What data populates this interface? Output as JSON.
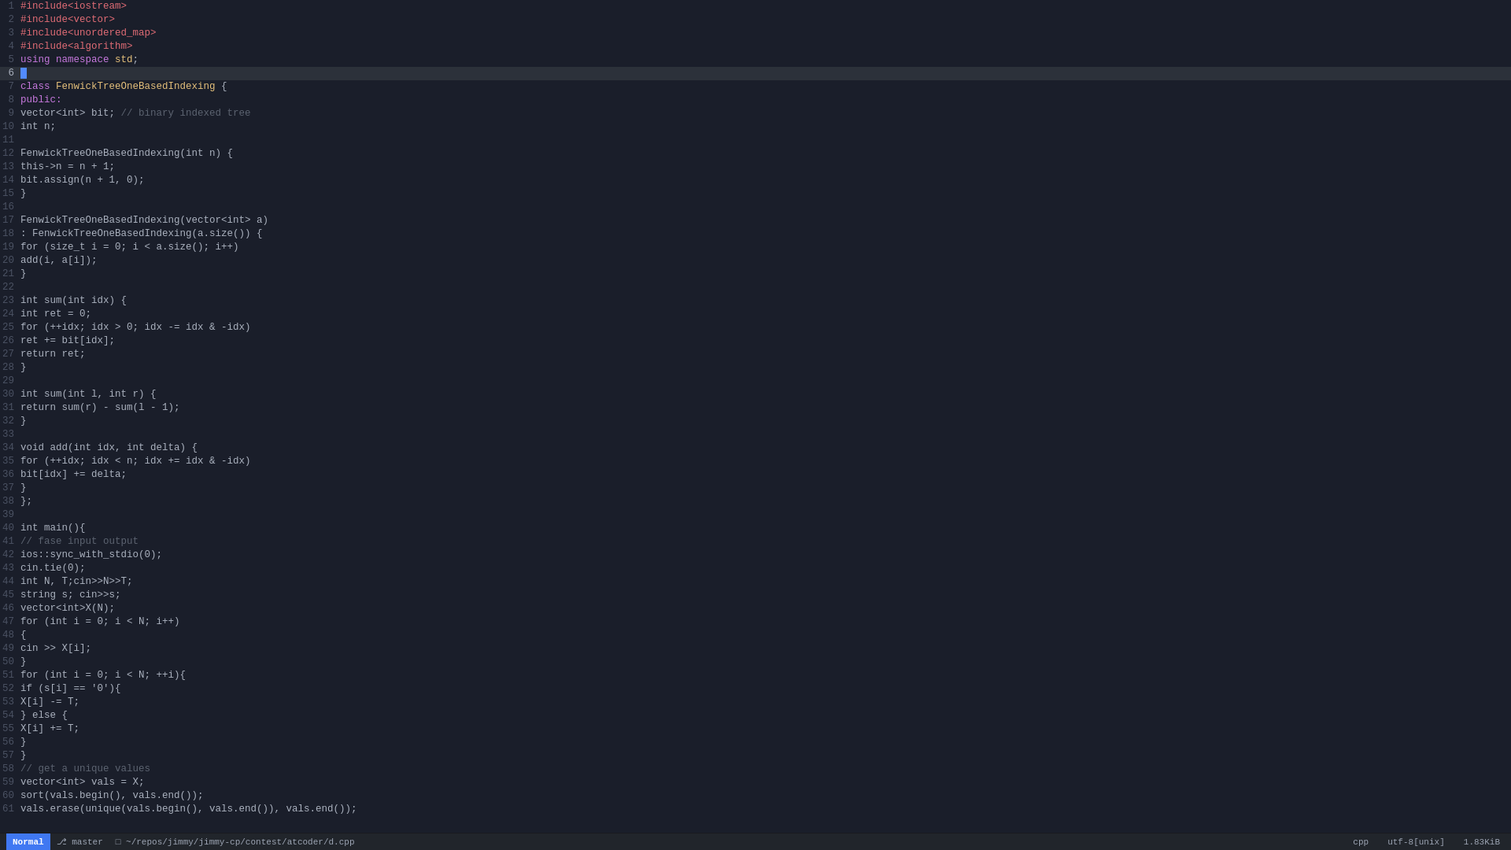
{
  "editor": {
    "title": "d.cpp",
    "language": "cpp",
    "encoding": "utf-8[unix]",
    "size": "1.83KiB",
    "lines": [
      {
        "num": 1,
        "tokens": [
          {
            "t": "#include<iostream>",
            "c": "pp"
          }
        ]
      },
      {
        "num": 2,
        "tokens": [
          {
            "t": "#include<vector>",
            "c": "pp"
          }
        ]
      },
      {
        "num": 3,
        "tokens": [
          {
            "t": "#include<unordered_map>",
            "c": "pp"
          }
        ]
      },
      {
        "num": 4,
        "tokens": [
          {
            "t": "#include<algorithm>",
            "c": "pp"
          }
        ]
      },
      {
        "num": 5,
        "tokens": [
          {
            "t": "using ",
            "c": "kw"
          },
          {
            "t": "namespace ",
            "c": "kw"
          },
          {
            "t": "std",
            "c": "ns"
          },
          {
            "t": ";",
            "c": "plain"
          }
        ]
      },
      {
        "num": 6,
        "tokens": [],
        "active": true
      },
      {
        "num": 7,
        "tokens": [
          {
            "t": "class ",
            "c": "kw"
          },
          {
            "t": "FenwickTreeOneBasedIndexing",
            "c": "cls-name"
          },
          {
            "t": " {",
            "c": "plain"
          }
        ]
      },
      {
        "num": 8,
        "tokens": [
          {
            "t": "    public:",
            "c": "kw"
          }
        ]
      },
      {
        "num": 9,
        "tokens": [
          {
            "t": "        vector<int> bit;  ",
            "c": "plain"
          },
          {
            "t": "// binary indexed tree",
            "c": "cm"
          }
        ]
      },
      {
        "num": 10,
        "tokens": [
          {
            "t": "        int n;",
            "c": "plain"
          }
        ]
      },
      {
        "num": 11,
        "tokens": []
      },
      {
        "num": 12,
        "tokens": [
          {
            "t": "        FenwickTreeOneBasedIndexing(int n) {",
            "c": "plain"
          }
        ]
      },
      {
        "num": 13,
        "tokens": [
          {
            "t": "            this->n = n + 1;",
            "c": "plain"
          }
        ]
      },
      {
        "num": 14,
        "tokens": [
          {
            "t": "            bit.assign(n + 1, 0);",
            "c": "plain"
          }
        ]
      },
      {
        "num": 15,
        "tokens": [
          {
            "t": "        }",
            "c": "plain"
          }
        ]
      },
      {
        "num": 16,
        "tokens": []
      },
      {
        "num": 17,
        "tokens": [
          {
            "t": "        FenwickTreeOneBasedIndexing(vector<int> a)",
            "c": "plain"
          }
        ]
      },
      {
        "num": 18,
        "tokens": [
          {
            "t": "            : FenwickTreeOneBasedIndexing(a.size()) {",
            "c": "plain"
          }
        ]
      },
      {
        "num": 19,
        "tokens": [
          {
            "t": "            for (size_t i = 0; i < a.size(); i++)",
            "c": "plain"
          }
        ]
      },
      {
        "num": 20,
        "tokens": [
          {
            "t": "                add(i, a[i]);",
            "c": "plain"
          }
        ]
      },
      {
        "num": 21,
        "tokens": [
          {
            "t": "        }",
            "c": "plain"
          }
        ]
      },
      {
        "num": 22,
        "tokens": []
      },
      {
        "num": 23,
        "tokens": [
          {
            "t": "        int sum(int idx) {",
            "c": "plain"
          }
        ]
      },
      {
        "num": 24,
        "tokens": [
          {
            "t": "            int ret = 0;",
            "c": "plain"
          }
        ]
      },
      {
        "num": 25,
        "tokens": [
          {
            "t": "            for (++idx; idx > 0; idx -= idx & -idx)",
            "c": "plain"
          }
        ]
      },
      {
        "num": 26,
        "tokens": [
          {
            "t": "                ret += bit[idx];",
            "c": "plain"
          }
        ]
      },
      {
        "num": 27,
        "tokens": [
          {
            "t": "            return ret;",
            "c": "plain"
          }
        ]
      },
      {
        "num": 28,
        "tokens": [
          {
            "t": "        }",
            "c": "plain"
          }
        ]
      },
      {
        "num": 29,
        "tokens": []
      },
      {
        "num": 30,
        "tokens": [
          {
            "t": "        int sum(int l, int r) {",
            "c": "plain"
          }
        ]
      },
      {
        "num": 31,
        "tokens": [
          {
            "t": "            return sum(r) - sum(l - 1);",
            "c": "plain"
          }
        ]
      },
      {
        "num": 32,
        "tokens": [
          {
            "t": "        }",
            "c": "plain"
          }
        ]
      },
      {
        "num": 33,
        "tokens": []
      },
      {
        "num": 34,
        "tokens": [
          {
            "t": "        void add(int idx, int delta) {",
            "c": "plain"
          }
        ]
      },
      {
        "num": 35,
        "tokens": [
          {
            "t": "            for (++idx; idx < n; idx += idx & -idx)",
            "c": "plain"
          }
        ]
      },
      {
        "num": 36,
        "tokens": [
          {
            "t": "                bit[idx] += delta;",
            "c": "plain"
          }
        ]
      },
      {
        "num": 37,
        "tokens": [
          {
            "t": "        }",
            "c": "plain"
          }
        ]
      },
      {
        "num": 38,
        "tokens": [
          {
            "t": "};",
            "c": "plain"
          }
        ]
      },
      {
        "num": 39,
        "tokens": []
      },
      {
        "num": 40,
        "tokens": [
          {
            "t": "int main(){",
            "c": "plain"
          }
        ]
      },
      {
        "num": 41,
        "tokens": [
          {
            "t": "    ",
            "c": "plain"
          },
          {
            "t": "// fase input output",
            "c": "cm"
          }
        ]
      },
      {
        "num": 42,
        "tokens": [
          {
            "t": "    ios::sync_with_stdio(0);",
            "c": "plain"
          }
        ]
      },
      {
        "num": 43,
        "tokens": [
          {
            "t": "    cin.tie(0);",
            "c": "plain"
          }
        ]
      },
      {
        "num": 44,
        "tokens": [
          {
            "t": "    int N, T;cin>>N>>T;",
            "c": "plain"
          }
        ]
      },
      {
        "num": 45,
        "tokens": [
          {
            "t": "    string s; cin>>s;",
            "c": "plain"
          }
        ]
      },
      {
        "num": 46,
        "tokens": [
          {
            "t": "    vector<int>X(N);",
            "c": "plain"
          }
        ]
      },
      {
        "num": 47,
        "tokens": [
          {
            "t": "    for (int i = 0; i < N; i++)",
            "c": "plain"
          }
        ]
      },
      {
        "num": 48,
        "tokens": [
          {
            "t": "    {",
            "c": "plain"
          }
        ]
      },
      {
        "num": 49,
        "tokens": [
          {
            "t": "        cin >> X[i];",
            "c": "plain"
          }
        ]
      },
      {
        "num": 50,
        "tokens": [
          {
            "t": "    }",
            "c": "plain"
          }
        ]
      },
      {
        "num": 51,
        "tokens": [
          {
            "t": "    for (int i = 0; i < N; ++i){",
            "c": "plain"
          }
        ]
      },
      {
        "num": 52,
        "tokens": [
          {
            "t": "        if (s[i] == '0'){",
            "c": "plain"
          }
        ]
      },
      {
        "num": 53,
        "tokens": [
          {
            "t": "            X[i] -= T;",
            "c": "plain"
          }
        ]
      },
      {
        "num": 54,
        "tokens": [
          {
            "t": "        } else {",
            "c": "plain"
          }
        ]
      },
      {
        "num": 55,
        "tokens": [
          {
            "t": "            X[i] += T;",
            "c": "plain"
          }
        ]
      },
      {
        "num": 56,
        "tokens": [
          {
            "t": "        }",
            "c": "plain"
          }
        ]
      },
      {
        "num": 57,
        "tokens": [
          {
            "t": "    }",
            "c": "plain"
          }
        ]
      },
      {
        "num": 58,
        "tokens": [
          {
            "t": "    ",
            "c": "plain"
          },
          {
            "t": "// get a unique values",
            "c": "cm"
          }
        ]
      },
      {
        "num": 59,
        "tokens": [
          {
            "t": "    vector<int> vals = X;",
            "c": "plain"
          }
        ]
      },
      {
        "num": 60,
        "tokens": [
          {
            "t": "    sort(vals.begin(), vals.end());",
            "c": "plain"
          }
        ]
      },
      {
        "num": 61,
        "tokens": [
          {
            "t": "    vals.erase(unique(vals.begin(), vals.end()), vals.end());",
            "c": "plain"
          }
        ]
      }
    ]
  },
  "status_bar": {
    "mode": "Normal",
    "git_branch": "master",
    "git_icon": "⎇",
    "path": "~/repos/jimmy/jimmy-cp/contest/atcoder/d.cpp",
    "file_type": "cpp",
    "encoding": "utf-8[unix]",
    "file_size": "1.83KiB"
  }
}
